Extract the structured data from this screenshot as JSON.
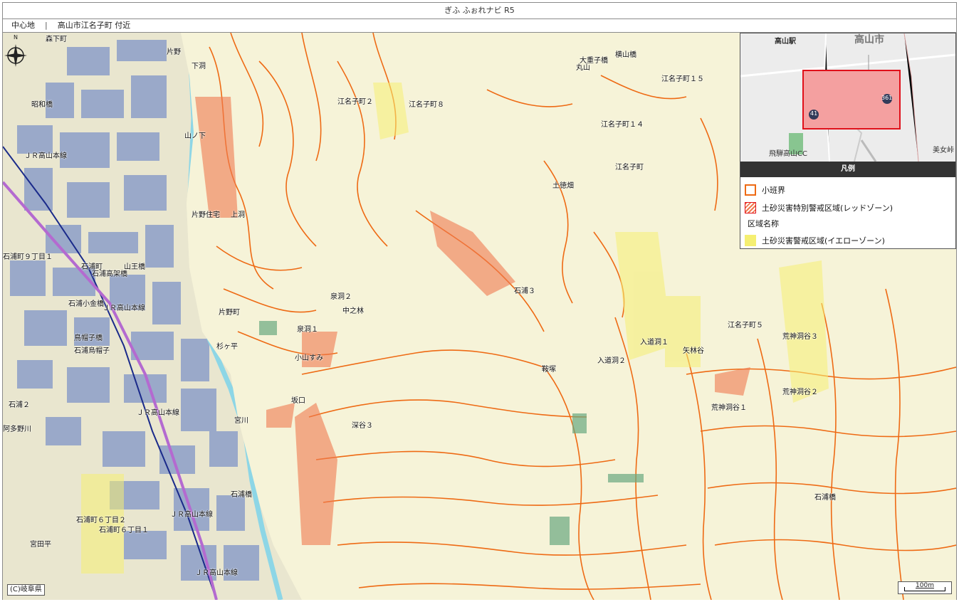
{
  "app": {
    "title": "ぎふ ふぉれナビ R5"
  },
  "location": {
    "label": "中心地",
    "separator": "|",
    "value": "高山市江名子町 付近"
  },
  "map": {
    "copyright": "(C)岐阜県",
    "scale": "100m",
    "labels": [
      "森下町",
      "片野",
      "下洞",
      "昭和橋",
      "山ノ下",
      "ＪＲ高山本線",
      "片野住宅",
      "上洞",
      "江名子町２",
      "江名子町８",
      "丸山",
      "大重子橋",
      "横山橋",
      "江名子町１５",
      "江名子町１４",
      "江名子町",
      "土徳畑",
      "石浦町９丁目１",
      "石浦高架橋",
      "山王橋",
      "石浦小金橋",
      "ＪＲ高山本線",
      "鳥帽子橋",
      "石浦烏帽子",
      "片野町",
      "杉ヶ平",
      "泉洞２",
      "泉洞１",
      "中之林",
      "小山すみ",
      "坂口",
      "宮川",
      "深谷３",
      "石浦３",
      "石浦２",
      "ＪＲ高山本線",
      "ＪＲ高山本線",
      "石浦町６丁目２",
      "石浦町６丁目１",
      "宮田平",
      "ＪＲ高山本線",
      "入道洞１",
      "入道洞２",
      "矢林谷",
      "鞍塚",
      "江名子町５",
      "荒神洞谷３",
      "荒神洞谷２",
      "荒神洞谷１",
      "石浦橋",
      "石浦町",
      "阿多野川",
      "石浦橋"
    ]
  },
  "overview": {
    "labels": [
      "高山駅",
      "高山市",
      "飛騨高山CC",
      "美女峠"
    ],
    "route_badges": [
      "41",
      "361"
    ],
    "colors": {
      "highlight": "#f4a0a0",
      "highlight_border": "#e0101a"
    }
  },
  "legend": {
    "header": "凡例",
    "items": [
      {
        "label": "小班界"
      },
      {
        "label": "土砂災害特別警戒区域(レッドゾーン)"
      },
      {
        "label": "区域名称"
      },
      {
        "label": "土砂災害警戒区域(イエローゾーン)"
      }
    ]
  },
  "colors": {
    "boundary": "#ee6a14",
    "red_zone": "#f07a50",
    "yellow_zone": "#f5ef72",
    "base": "#f4f1d6",
    "river": "#8dd6e6",
    "building": "#8d9fc9"
  }
}
